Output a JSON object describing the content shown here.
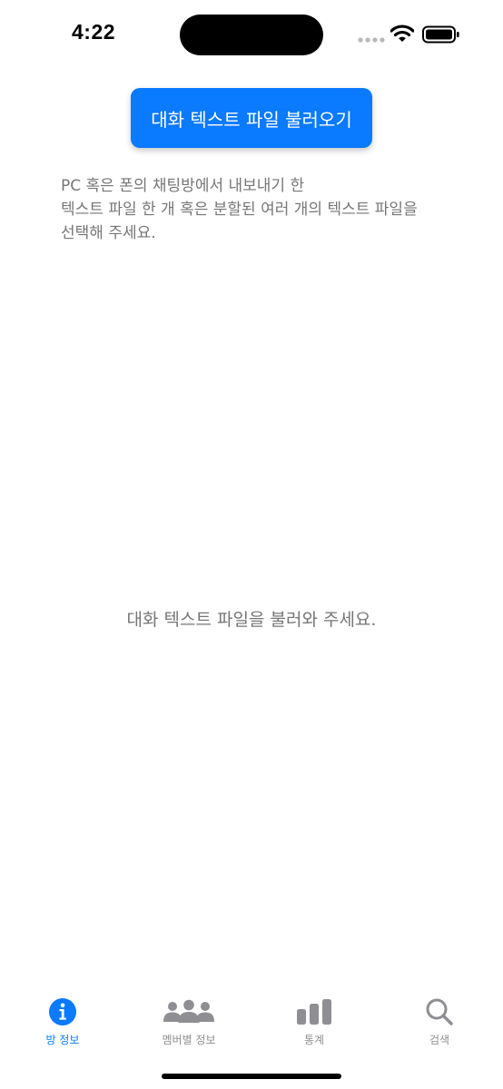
{
  "status_bar": {
    "time": "4:22"
  },
  "main": {
    "load_button_label": "대화 텍스트 파일 불러오기",
    "instructions": [
      "PC 혹은 폰의 채팅방에서 내보내기 한",
      "텍스트 파일 한 개 혹은 분할된 여러 개의 텍스트 파일을",
      "선택해 주세요."
    ],
    "empty_message": "대화 텍스트 파일을 불러와 주세요."
  },
  "tab_bar": {
    "tabs": [
      {
        "label": "방 정보",
        "icon": "info-circle-icon",
        "active": true
      },
      {
        "label": "멤버별 정보",
        "icon": "people-icon",
        "active": false
      },
      {
        "label": "통계",
        "icon": "bar-chart-icon",
        "active": false
      },
      {
        "label": "검색",
        "icon": "search-icon",
        "active": false
      }
    ]
  },
  "colors": {
    "accent": "#0a7aff",
    "secondary_text": "#767676",
    "inactive_tab": "#8e8e93"
  }
}
